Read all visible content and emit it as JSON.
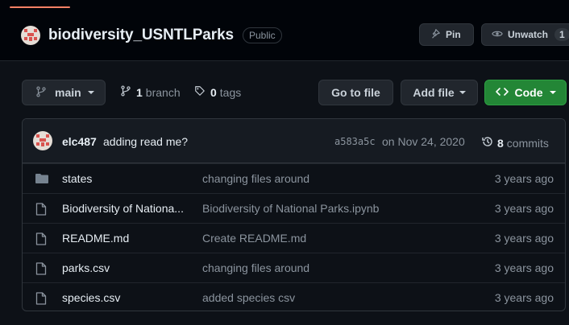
{
  "repo": {
    "name": "biodiversity_USNTLParks",
    "visibility": "Public"
  },
  "header_actions": {
    "pin_label": "Pin",
    "unwatch_label": "Unwatch",
    "unwatch_count": "1"
  },
  "branch_bar": {
    "branch_name": "main",
    "branch_count": "1",
    "branch_word": "branch",
    "tag_count": "0",
    "tag_word": "tags",
    "go_to_file_label": "Go to file",
    "add_file_label": "Add file",
    "code_label": "Code"
  },
  "latest_commit": {
    "author": "elc487",
    "message": "adding read me?",
    "sha": "a583a5c",
    "date": "on Nov 24, 2020",
    "commit_count": "8",
    "commit_word": "commits"
  },
  "files": [
    {
      "type": "folder",
      "icon": "folder-icon",
      "name": "states",
      "message": "changing files around",
      "age": "3 years ago"
    },
    {
      "type": "file",
      "icon": "file-icon",
      "name": "Biodiversity of Nationa...",
      "message": "Biodiversity of National Parks.ipynb",
      "age": "3 years ago"
    },
    {
      "type": "file",
      "icon": "file-icon",
      "name": "README.md",
      "message": "Create README.md",
      "age": "3 years ago"
    },
    {
      "type": "file",
      "icon": "file-icon",
      "name": "parks.csv",
      "message": "changing files around",
      "age": "3 years ago"
    },
    {
      "type": "file",
      "icon": "file-icon",
      "name": "species.csv",
      "message": "added species csv",
      "age": "3 years ago"
    }
  ],
  "colors": {
    "background": "#0d1117",
    "code_button": "#238636",
    "tab_accent": "#f78166"
  }
}
